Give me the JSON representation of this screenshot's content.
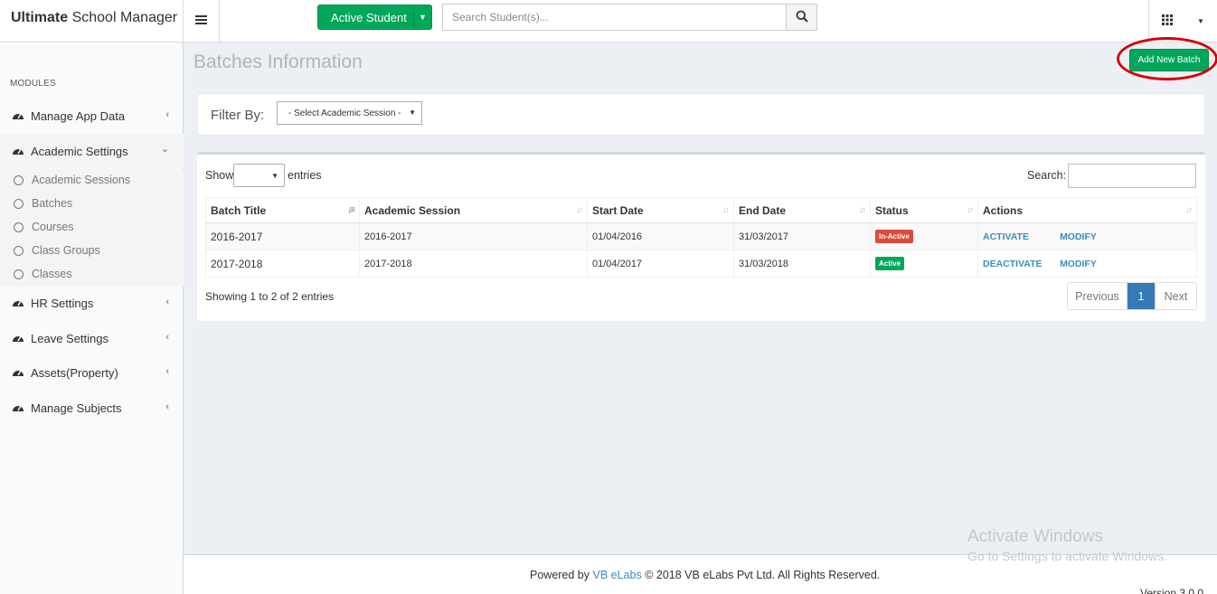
{
  "header": {
    "brand_bold": "Ultimate",
    "brand_rest": " School Manager",
    "active_student_label": "Active Student",
    "search_placeholder": "Search Student(s)..."
  },
  "sidebar": {
    "section_title": "MODULES",
    "items": [
      {
        "label": "Manage App Data"
      },
      {
        "label": "Academic Settings"
      },
      {
        "label": "HR Settings"
      },
      {
        "label": "Leave Settings"
      },
      {
        "label": "Assets(Property)"
      },
      {
        "label": "Manage Subjects"
      }
    ],
    "academic_submenu": [
      {
        "label": "Academic Sessions"
      },
      {
        "label": "Batches"
      },
      {
        "label": "Courses"
      },
      {
        "label": "Class Groups"
      },
      {
        "label": "Classes"
      }
    ]
  },
  "page": {
    "title": "Batches Information",
    "add_button": "Add New Batch"
  },
  "filter": {
    "label": "Filter By:",
    "session_select": "- Select Academic Session -"
  },
  "table": {
    "show_label": "Show",
    "entries_label": "entries",
    "search_label": "Search:",
    "columns": [
      "Batch Title",
      "Academic Session",
      "Start Date",
      "End Date",
      "Status",
      "Actions"
    ],
    "rows": [
      {
        "batch": "2016-2017",
        "session": "2016-2017",
        "start": "01/04/2016",
        "end": "31/03/2017",
        "status": "In-Active",
        "action1": "ACTIVATE",
        "action2": "MODIFY"
      },
      {
        "batch": "2017-2018",
        "session": "2017-2018",
        "start": "01/04/2017",
        "end": "31/03/2018",
        "status": "Active",
        "action1": "DEACTIVATE",
        "action2": "MODIFY"
      }
    ],
    "info": "Showing 1 to 2 of 2 entries",
    "pager": {
      "previous": "Previous",
      "page": "1",
      "next": "Next"
    }
  },
  "footer": {
    "powered_by": "Powered by",
    "company_link": "VB eLabs",
    "copyright": "© 2018 VB eLabs Pvt Ltd. All Rights Reserved.",
    "version": "Version 3.0.0"
  },
  "watermark": {
    "line1": "Activate Windows",
    "line2": "Go to Settings to activate Windows."
  },
  "colors": {
    "green": "#00a65a",
    "red_badge": "#dd4b39",
    "link_blue": "#3c8dbc",
    "page_blue": "#337ab7",
    "highlight_ring": "#d60000"
  }
}
